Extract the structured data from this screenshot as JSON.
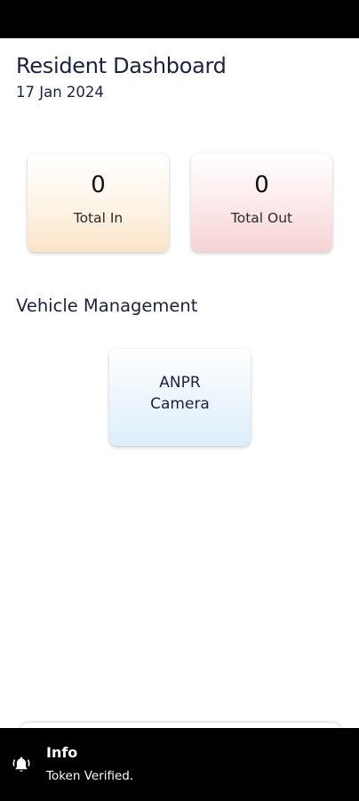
{
  "header": {
    "title": "Resident Dashboard",
    "date": "17 Jan 2024"
  },
  "stats": {
    "total_in": {
      "value": "0",
      "label": "Total In"
    },
    "total_out": {
      "value": "0",
      "label": "Total Out"
    }
  },
  "vehicle_management": {
    "section_title": "Vehicle Management",
    "anpr_card": {
      "line1": "ANPR",
      "line2": "Camera"
    }
  },
  "toast": {
    "icon": "bell-ringing-icon",
    "title": "Info",
    "message": "Token Verified."
  },
  "colors": {
    "text_primary": "#1d2140",
    "total_in_tint": "#fbe4c8",
    "total_out_tint": "#f6d3d5",
    "anpr_tint": "#dbeefb",
    "toast_background": "#000000"
  }
}
